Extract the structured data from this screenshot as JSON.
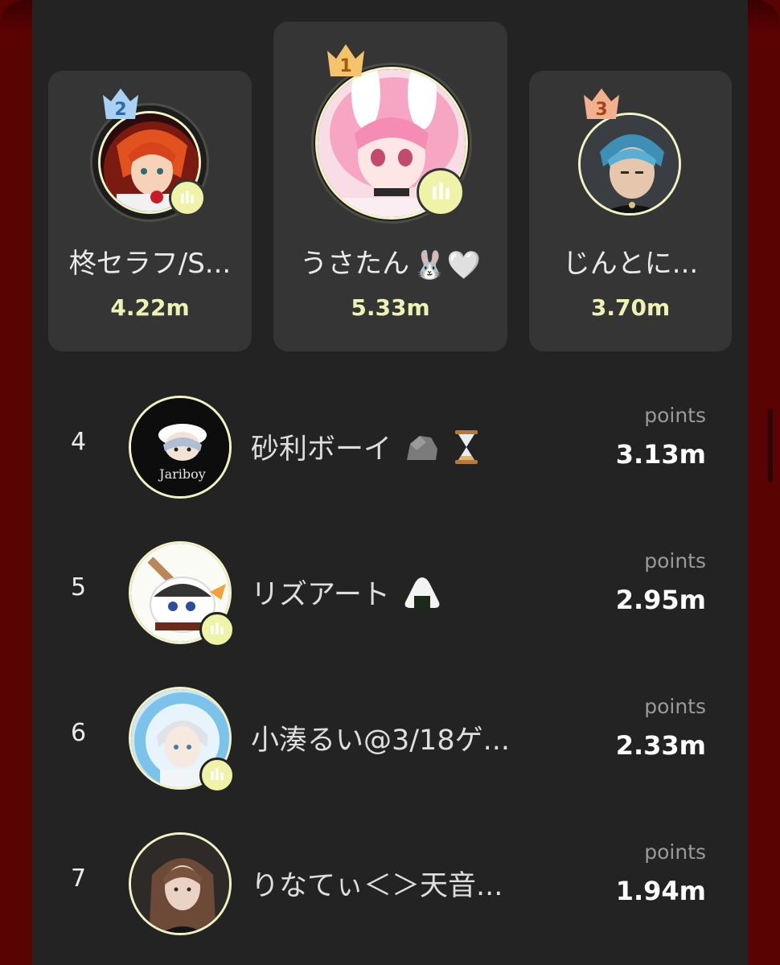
{
  "podium": [
    {
      "rank_label": "2",
      "name": "柊セラフ/S...",
      "score": "4.22m",
      "crown_color": "#a9d2f2",
      "crown_text_color": "#2e6aa8"
    },
    {
      "rank_label": "1",
      "name": "うさたん",
      "name_emoji": "🐰🤍",
      "score": "5.33m",
      "crown_color": "#f4c36c",
      "crown_text_color": "#a05a10"
    },
    {
      "rank_label": "3",
      "name": "じんとに...",
      "score": "3.70m",
      "crown_color": "#f3b08d",
      "crown_text_color": "#a0461c"
    }
  ],
  "rows": [
    {
      "rank": "4",
      "name": "砂利ボーイ",
      "points_label": "points",
      "points": "3.13m",
      "emoji": [
        "rock",
        "hourglass"
      ],
      "live": false
    },
    {
      "rank": "5",
      "name": "リズアート",
      "points_label": "points",
      "points": "2.95m",
      "emoji": [
        "onigiri"
      ],
      "live": true
    },
    {
      "rank": "6",
      "name": "小湊るい@3/18ゲ...",
      "points_label": "points",
      "points": "2.33m",
      "emoji": [],
      "live": true
    },
    {
      "rank": "7",
      "name": "りなてぃ＜＞天音...",
      "points_label": "points",
      "points": "1.94m",
      "emoji": [],
      "live": false
    }
  ],
  "avatar_texts": {
    "jariboy": "Jariboy"
  },
  "colors": {
    "accent_score": "#eef3b4",
    "live_badge": "#eef3a8",
    "panel": "#232323",
    "card": "#353535"
  }
}
